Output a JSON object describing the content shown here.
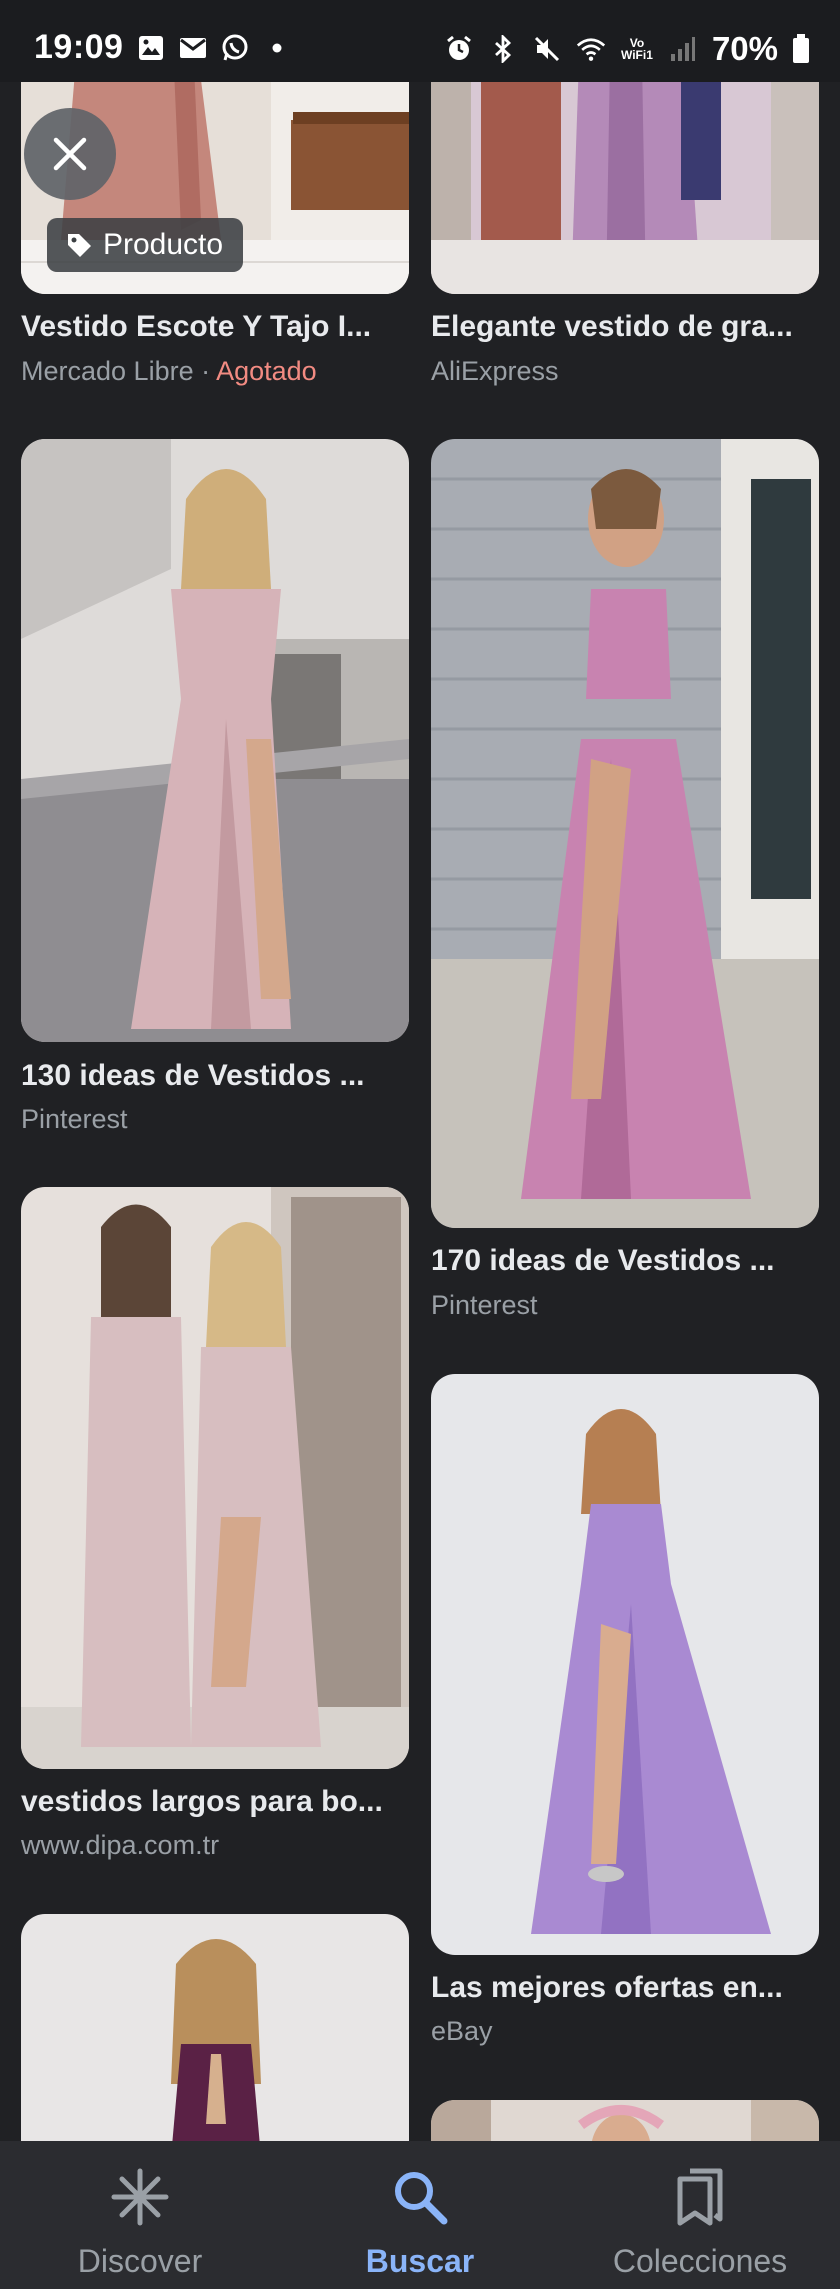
{
  "status_bar": {
    "time": "19:09",
    "battery": "70%",
    "network_label": "Vo WiFi1"
  },
  "overlay": {
    "product_chip_label": "Producto"
  },
  "results": [
    {
      "title": "Vestido Escote Y Tajo I...",
      "source": "Mercado Libre",
      "separator": " · ",
      "status": "Agotado",
      "palette": [
        "#c4877c",
        "#e6dfd8",
        "#8a5434"
      ]
    },
    {
      "title": "Elegante vestido de gra...",
      "source": "AliExpress",
      "palette": [
        "#b48ab8",
        "#d8c8d4",
        "#6a3a8a"
      ]
    },
    {
      "title": "130 ideas de Vestidos ...",
      "source": "Pinterest",
      "palette": [
        "#d6b3b8",
        "#dedbd9",
        "#7a7775"
      ]
    },
    {
      "title": "170 ideas de Vestidos ...",
      "source": "Pinterest",
      "palette": [
        "#c883b0",
        "#a8acb3",
        "#e8e6e2"
      ]
    },
    {
      "title": "vestidos largos para bo...",
      "source": "www.dipa.com.tr",
      "palette": [
        "#d7bec0",
        "#e6e0dc",
        "#8c7d74"
      ]
    },
    {
      "title": "Las mejores ofertas en...",
      "source": "eBay",
      "palette": [
        "#a98ad2",
        "#e6e7ea",
        "#c7a07a"
      ]
    },
    {
      "title": "",
      "source": "",
      "palette": [
        "#5a2145",
        "#e8e6e6",
        "#d6b08e"
      ]
    },
    {
      "title": "",
      "source": "",
      "palette": [
        "#e0d8d2",
        "#b9a89b",
        "#7a5c4c"
      ]
    }
  ],
  "bottom_nav": {
    "items": [
      {
        "label": "Discover",
        "icon": "discover-asterisk-icon"
      },
      {
        "label": "Buscar",
        "icon": "search-icon"
      },
      {
        "label": "Colecciones",
        "icon": "collections-bookmark-icon"
      }
    ],
    "active": "Buscar"
  },
  "colors": {
    "background": "#202124",
    "accent": "#8ab4f8",
    "out_of_stock": "#f28b82"
  }
}
